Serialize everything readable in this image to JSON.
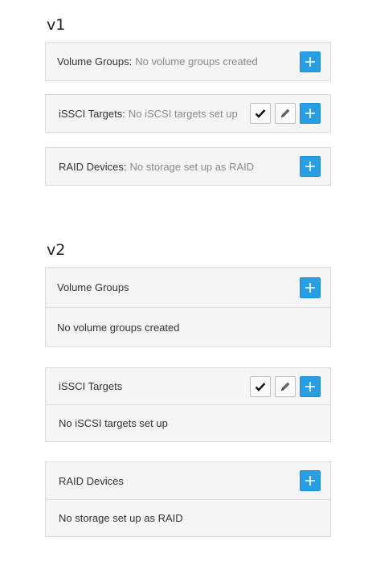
{
  "v1": {
    "heading": "v1",
    "panels": [
      {
        "title": "Volume Groups:",
        "status": "No volume groups created"
      },
      {
        "title": "iSSCI Targets:",
        "status": "No iSCSI targets set up"
      },
      {
        "title": "RAID Devices:",
        "status": "No storage set up as RAID"
      }
    ]
  },
  "v2": {
    "heading": "v2",
    "panels": [
      {
        "title": "Volume Groups",
        "status": "No volume groups created"
      },
      {
        "title": "iSSCI Targets",
        "status": "No iSCSI targets set up"
      },
      {
        "title": "RAID Devices",
        "status": "No storage set up as RAID"
      }
    ]
  },
  "icons": {
    "add": "plus-icon",
    "confirm": "check-icon",
    "edit": "pencil-icon"
  },
  "colors": {
    "accent": "#2a9ee3",
    "panel_bg": "#f5f5f5",
    "muted_text": "#8a8a8a"
  }
}
